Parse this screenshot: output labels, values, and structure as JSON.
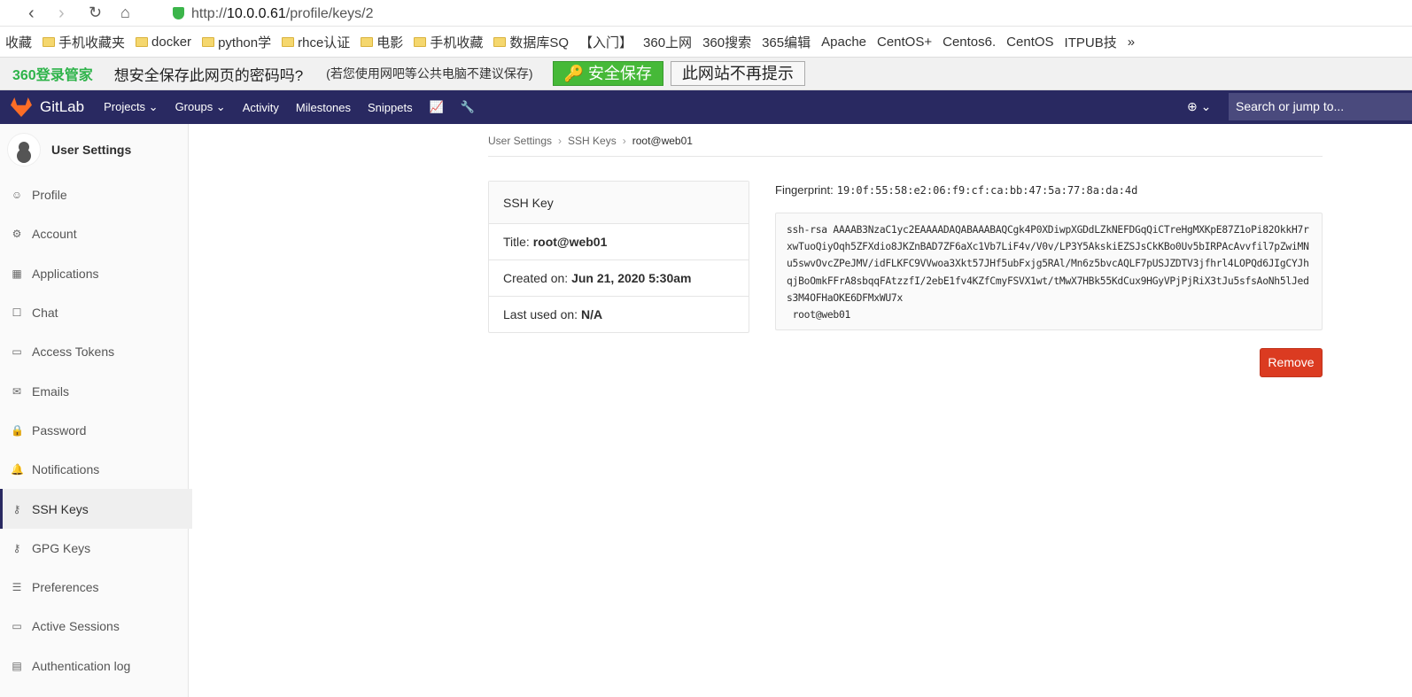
{
  "browser": {
    "url_prefix": "http://",
    "url_host": "10.0.0.61",
    "url_path": "/profile/keys/2"
  },
  "bookmarks": [
    "收藏",
    "手机收藏夹",
    "docker",
    "python学",
    "rhce认证",
    "电影",
    "手机收藏",
    "数据库SQ",
    "【入门】",
    "360上网",
    "360搜索",
    "365编辑",
    "Apache",
    "CentOS+",
    "Centos6.",
    "CentOS",
    "ITPUB技",
    "»"
  ],
  "password_bar": {
    "logo": "360登录管家",
    "question": "想安全保存此网页的密码吗?",
    "hint": "(若您使用网吧等公共电脑不建议保存)",
    "save": "安全保存",
    "never": "此网站不再提示"
  },
  "gitlab_nav": {
    "brand": "GitLab",
    "items": [
      "Projects ⌄",
      "Groups ⌄",
      "Activity",
      "Milestones",
      "Snippets"
    ],
    "search_placeholder": "Search or jump to...",
    "plus": "⊕ ⌄"
  },
  "sidebar": {
    "title": "User Settings",
    "items": [
      {
        "label": "Profile",
        "icon": "☺"
      },
      {
        "label": "Account",
        "icon": "⚙"
      },
      {
        "label": "Applications",
        "icon": "▦"
      },
      {
        "label": "Chat",
        "icon": "☐"
      },
      {
        "label": "Access Tokens",
        "icon": "▭"
      },
      {
        "label": "Emails",
        "icon": "✉"
      },
      {
        "label": "Password",
        "icon": "🔒"
      },
      {
        "label": "Notifications",
        "icon": "🔔"
      },
      {
        "label": "SSH Keys",
        "icon": "⚷"
      },
      {
        "label": "GPG Keys",
        "icon": "⚷"
      },
      {
        "label": "Preferences",
        "icon": "☰"
      },
      {
        "label": "Active Sessions",
        "icon": "▭"
      },
      {
        "label": "Authentication log",
        "icon": "▤"
      }
    ],
    "active": "SSH Keys"
  },
  "breadcrumb": [
    "User Settings",
    "SSH Keys",
    "root@web01"
  ],
  "card": {
    "header": "SSH Key",
    "title_label": "Title:",
    "title": "root@web01",
    "created_label": "Created on:",
    "created": "Jun 21, 2020 5:30am",
    "used_label": "Last used on:",
    "used": "N/A"
  },
  "fingerprint": {
    "label": "Fingerprint:",
    "value": "19:0f:55:58:e2:06:f9:cf:ca:bb:47:5a:77:8a:da:4d"
  },
  "key": "ssh-rsa AAAAB3NzaC1yc2EAAAADAQABAAABAQCgk4P0XDiwpXGDdLZkNEFDGqQiCTreHgMXKpE87Z1oPi82OkkH7rxwTuoQiyOqh5ZFXdio8JKZnBAD7ZF6aXc1Vb7LiF4v/V0v/LP3Y5AkskiEZSJsCkKBo0Uv5bIRPAcAvvfil7pZwiMNu5swvOvcZPeJMV/idFLKFC9VVwoa3Xkt57JHf5ubFxjg5RAl/Mn6z5bvcAQLF7pUSJZDTV3jfhrl4LOPQd6JIgCYJhqjBoOmkFFrA8sbqqFAtzzfI/2ebE1fv4KZfCmyFSVX1wt/tMwX7HBk55KdCux9HGyVPjPjRiX3tJu5sfsAoNh5lJeds3M4OFHaOKE6DFMxWU7x\n root@web01",
  "remove": "Remove"
}
